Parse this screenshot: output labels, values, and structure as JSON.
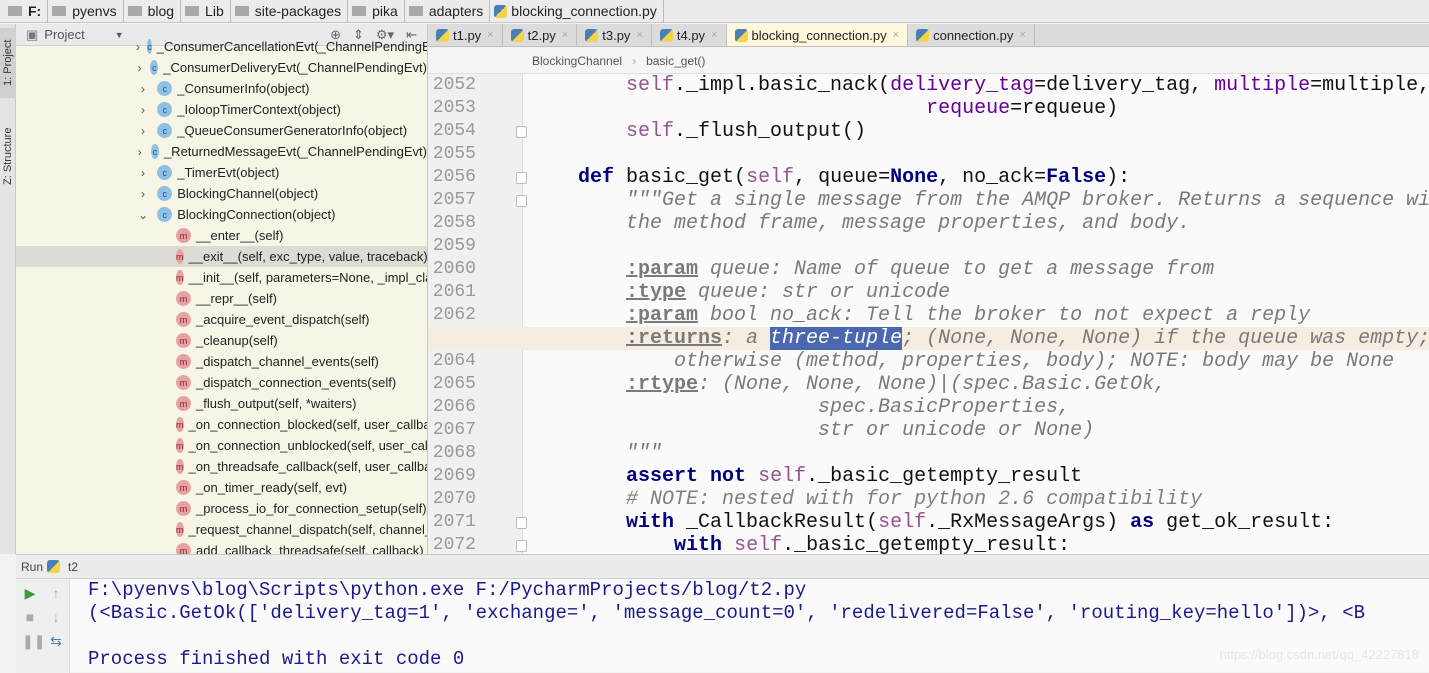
{
  "breadcrumb": [
    "F:",
    "pyenvs",
    "blog",
    "Lib",
    "site-packages",
    "pika",
    "adapters",
    "blocking_connection.py"
  ],
  "side_tabs": {
    "project": "1: Project",
    "structure": "Z: Structure"
  },
  "project_panel": {
    "title": "Project",
    "items": [
      {
        "label": "_ConsumerCancellationEvt(_ChannelPendingEvt)",
        "kind": "c",
        "expanded": false
      },
      {
        "label": "_ConsumerDeliveryEvt(_ChannelPendingEvt)",
        "kind": "c",
        "expanded": false
      },
      {
        "label": "_ConsumerInfo(object)",
        "kind": "c",
        "expanded": false
      },
      {
        "label": "_IoloopTimerContext(object)",
        "kind": "c",
        "expanded": false
      },
      {
        "label": "_QueueConsumerGeneratorInfo(object)",
        "kind": "c",
        "expanded": false
      },
      {
        "label": "_ReturnedMessageEvt(_ChannelPendingEvt)",
        "kind": "c",
        "expanded": false
      },
      {
        "label": "_TimerEvt(object)",
        "kind": "c",
        "expanded": false
      },
      {
        "label": "BlockingChannel(object)",
        "kind": "c",
        "expanded": false
      },
      {
        "label": "BlockingConnection(object)",
        "kind": "c",
        "expanded": true
      },
      {
        "label": "__enter__(self)",
        "kind": "m"
      },
      {
        "label": "__exit__(self, exc_type, value, traceback)",
        "kind": "m",
        "selected": true
      },
      {
        "label": "__init__(self, parameters=None, _impl_class=None)",
        "kind": "m"
      },
      {
        "label": "__repr__(self)",
        "kind": "m"
      },
      {
        "label": "_acquire_event_dispatch(self)",
        "kind": "m"
      },
      {
        "label": "_cleanup(self)",
        "kind": "m"
      },
      {
        "label": "_dispatch_channel_events(self)",
        "kind": "m"
      },
      {
        "label": "_dispatch_connection_events(self)",
        "kind": "m"
      },
      {
        "label": "_flush_output(self, *waiters)",
        "kind": "m"
      },
      {
        "label": "_on_connection_blocked(self, user_callback)",
        "kind": "m"
      },
      {
        "label": "_on_connection_unblocked(self, user_callback)",
        "kind": "m"
      },
      {
        "label": "_on_threadsafe_callback(self, user_callback)",
        "kind": "m"
      },
      {
        "label": "_on_timer_ready(self, evt)",
        "kind": "m"
      },
      {
        "label": "_process_io_for_connection_setup(self)",
        "kind": "m"
      },
      {
        "label": "_request_channel_dispatch(self, channel_number)",
        "kind": "m"
      },
      {
        "label": "add_callback_threadsafe(self, callback)",
        "kind": "m"
      }
    ]
  },
  "tabs": [
    {
      "label": "t1.py",
      "active": false
    },
    {
      "label": "t2.py",
      "active": false
    },
    {
      "label": "t3.py",
      "active": false
    },
    {
      "label": "t4.py",
      "active": false
    },
    {
      "label": "blocking_connection.py",
      "active": true
    },
    {
      "label": "connection.py",
      "active": false
    }
  ],
  "editor_breadcrumb": [
    "BlockingChannel",
    "basic_get()"
  ],
  "code": [
    {
      "n": "2052",
      "s": [
        [
          "        ",
          ""
        ],
        [
          "self",
          "sf"
        ],
        [
          "._impl.basic_nack(",
          ""
        ],
        [
          "delivery_tag",
          "pm"
        ],
        [
          "=delivery_tag, ",
          ""
        ],
        [
          "multiple",
          "pm"
        ],
        [
          "=multiple,",
          ""
        ]
      ]
    },
    {
      "n": "2053",
      "s": [
        [
          "                                 ",
          ""
        ],
        [
          "requeue",
          "pm"
        ],
        [
          "=requeue)",
          ""
        ]
      ]
    },
    {
      "n": "2054",
      "s": [
        [
          "        ",
          ""
        ],
        [
          "self",
          "sf"
        ],
        [
          "._flush_output()",
          ""
        ]
      ]
    },
    {
      "n": "2055",
      "s": []
    },
    {
      "n": "2056",
      "s": [
        [
          "    ",
          ""
        ],
        [
          "def",
          "kw"
        ],
        [
          " basic_get(",
          ""
        ],
        [
          "self",
          "sf"
        ],
        [
          ", queue=",
          ""
        ],
        [
          "None",
          "kw"
        ],
        [
          ", no_ack=",
          ""
        ],
        [
          "False",
          "kw"
        ],
        [
          "):",
          ""
        ]
      ]
    },
    {
      "n": "2057",
      "s": [
        [
          "        ",
          ""
        ],
        [
          "\"\"\"Get a single message from the AMQP broker. Returns a sequence with",
          "ds"
        ]
      ]
    },
    {
      "n": "2058",
      "s": [
        [
          "        ",
          ""
        ],
        [
          "the method frame, message properties, and body.",
          "ds"
        ]
      ]
    },
    {
      "n": "2059",
      "s": []
    },
    {
      "n": "2060",
      "s": [
        [
          "        ",
          ""
        ],
        [
          ":param",
          "tg"
        ],
        [
          " queue: Name of queue to get a message from",
          "ds"
        ]
      ]
    },
    {
      "n": "2061",
      "s": [
        [
          "        ",
          ""
        ],
        [
          ":type",
          "tg"
        ],
        [
          " queue: str or unicode",
          "ds"
        ]
      ]
    },
    {
      "n": "2062",
      "s": [
        [
          "        ",
          ""
        ],
        [
          ":param",
          "tg"
        ],
        [
          " bool no_ack: Tell the broker to not expect a reply",
          "ds"
        ]
      ]
    },
    {
      "n": "2063",
      "s": [
        [
          "        ",
          ""
        ],
        [
          ":returns",
          "tg"
        ],
        [
          ": a ",
          "ds"
        ],
        [
          "three-tuple",
          "ds selx"
        ],
        [
          "; (None, None, None) if the queue was empty;",
          "ds"
        ]
      ],
      "current": true
    },
    {
      "n": "2064",
      "s": [
        [
          "            otherwise (method, properties, body); NOTE: body may be None",
          "ds"
        ]
      ]
    },
    {
      "n": "2065",
      "s": [
        [
          "        ",
          ""
        ],
        [
          ":rtype",
          "tg"
        ],
        [
          ": (None, None, None)|(spec.Basic.GetOk,",
          "ds"
        ]
      ]
    },
    {
      "n": "2066",
      "s": [
        [
          "                        spec.BasicProperties,",
          "ds"
        ]
      ]
    },
    {
      "n": "2067",
      "s": [
        [
          "                        str or unicode or None)",
          "ds"
        ]
      ]
    },
    {
      "n": "2068",
      "s": [
        [
          "        ",
          ""
        ],
        [
          "\"\"\"",
          "ds"
        ]
      ]
    },
    {
      "n": "2069",
      "s": [
        [
          "        ",
          ""
        ],
        [
          "assert not",
          "kw"
        ],
        [
          " ",
          ""
        ],
        [
          "self",
          "sf"
        ],
        [
          "._basic_getempty_result",
          ""
        ]
      ]
    },
    {
      "n": "2070",
      "s": [
        [
          "        ",
          ""
        ],
        [
          "# NOTE: nested with for python 2.6 compatibility",
          "cm"
        ]
      ]
    },
    {
      "n": "2071",
      "s": [
        [
          "        ",
          ""
        ],
        [
          "with",
          "kw"
        ],
        [
          " _CallbackResult(",
          ""
        ],
        [
          "self",
          "sf"
        ],
        [
          "._RxMessageArgs) ",
          ""
        ],
        [
          "as",
          "kw"
        ],
        [
          " get_ok_result:",
          ""
        ]
      ]
    },
    {
      "n": "2072",
      "s": [
        [
          "            ",
          ""
        ],
        [
          "with",
          "kw"
        ],
        [
          " ",
          ""
        ],
        [
          "self",
          "sf"
        ],
        [
          "._basic_getempty_result:",
          ""
        ]
      ]
    }
  ],
  "run": {
    "label": "Run",
    "config": "t2",
    "output": [
      "F:\\pyenvs\\blog\\Scripts\\python.exe F:/PycharmProjects/blog/t2.py",
      "(<Basic.GetOk(['delivery_tag=1', 'exchange=', 'message_count=0', 'redelivered=False', 'routing_key=hello'])>, <B",
      "",
      "Process finished with exit code 0"
    ]
  },
  "watermark": "https://blog.csdn.net/qq_42227818"
}
